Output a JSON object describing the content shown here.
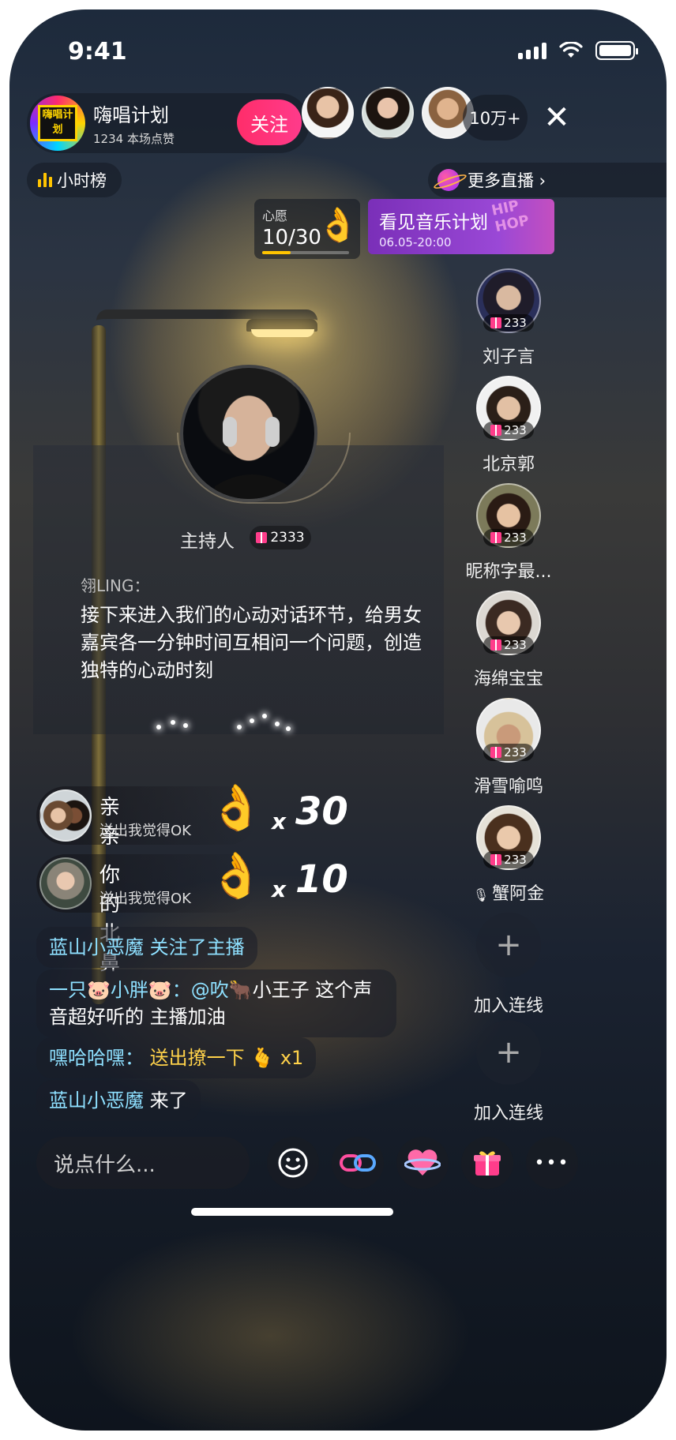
{
  "status_bar": {
    "time": "9:41"
  },
  "host": {
    "logo_text": "嗨唱计划",
    "name": "嗨唱计划",
    "likes": "1234 本场点赞",
    "follow_label": "关注"
  },
  "viewers": {
    "count_label": "10万+",
    "close_glyph": "✕"
  },
  "hour_rank_label": "小时榜",
  "more_live_label": "更多直播 ›",
  "wish": {
    "label": "心愿",
    "count": "10/30",
    "progress": 0.33,
    "emoji": "👌"
  },
  "event": {
    "title": "看见音乐计划",
    "date": "06.05-20:00",
    "deco": "HIP HOP"
  },
  "guests": [
    {
      "name": "刘子言",
      "gifts": "233",
      "muted": false
    },
    {
      "name": "北京郭",
      "gifts": "233",
      "muted": false
    },
    {
      "name": "昵称字最...",
      "gifts": "233",
      "muted": false
    },
    {
      "name": "海绵宝宝",
      "gifts": "233",
      "muted": false
    },
    {
      "name": "滑雪喻鸣",
      "gifts": "233",
      "muted": false
    },
    {
      "name": "蟹阿金",
      "gifts": "233",
      "muted": true
    }
  ],
  "join": {
    "plus": "+",
    "label": "加入连线"
  },
  "stage": {
    "role": "主持人",
    "gift_count": "2333",
    "speaker": "翎LING：",
    "speech": "接下来进入我们的心动对话环节，给男女嘉宾各一分钟时间互相问一个问题，创造独特的心动时刻"
  },
  "gift_events": [
    {
      "user": "亲亲",
      "desc": "送出我觉得OK",
      "emoji": "👌",
      "x": "x",
      "count": "30"
    },
    {
      "user": "你的北鼻",
      "desc": "送出我觉得OK",
      "emoji": "👌",
      "x": "x",
      "count": "10"
    }
  ],
  "chat": [
    {
      "name": "蓝山小恶魔",
      "text": "关注了主播"
    },
    {
      "name": "一只🐷小胖🐷：",
      "mention": "@吹🐂",
      "text": "小王子 这个声音超好听的 主播加油"
    },
    {
      "name": "嘿哈哈嘿：",
      "text": "送出撩一下",
      "emoji": "🫰",
      "count": "x1"
    },
    {
      "name": "蓝山小恶魔",
      "text": "来了"
    }
  ],
  "input": {
    "placeholder": "说点什么..."
  },
  "toolbar": {
    "emoji": "☺",
    "more": "•••"
  },
  "colors": {
    "follow": "#ff2d6a",
    "accent_cyan": "#8ee0ff",
    "accent_gold": "#ffd24a",
    "rank_bar": "#ffc400"
  }
}
